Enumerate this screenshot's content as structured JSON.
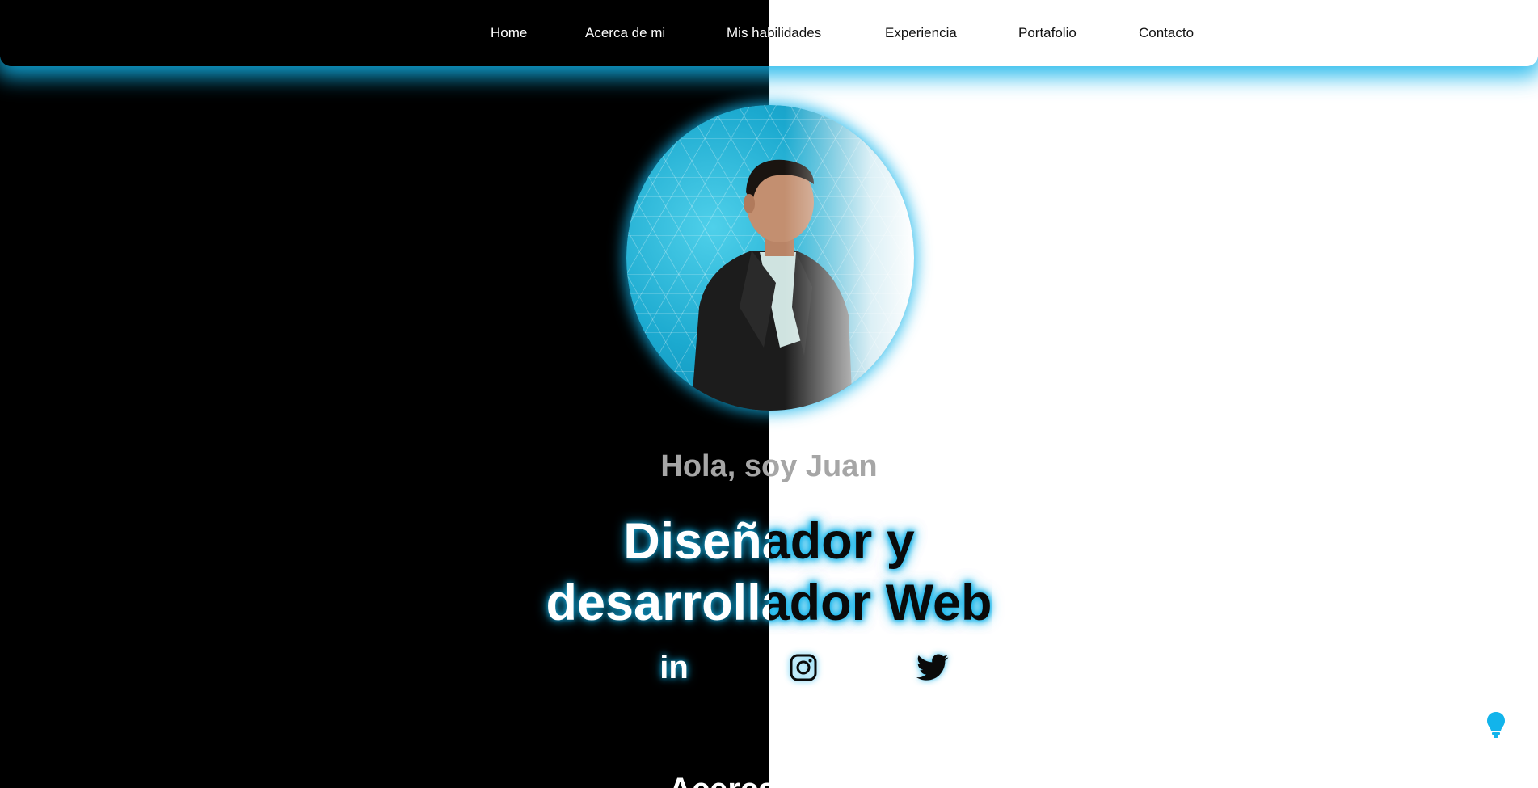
{
  "nav": {
    "items": [
      {
        "label": "Home"
      },
      {
        "label": "Acerca de mi"
      },
      {
        "label": "Mis habilidades"
      },
      {
        "label": "Experiencia"
      },
      {
        "label": "Portafolio"
      },
      {
        "label": "Contacto"
      }
    ]
  },
  "hero": {
    "greeting": "Hola, soy Juan",
    "headline_line1": "Diseñador y",
    "headline_line2": "desarrollador Web"
  },
  "social": {
    "linkedin_label": "in",
    "icons": [
      "linkedin-icon",
      "instagram-icon",
      "twitter-icon"
    ]
  },
  "next_section": {
    "heading": "Acerca de mí"
  },
  "colors": {
    "accent": "#12b4eb",
    "dark_bg": "#000000",
    "light_bg": "#ffffff",
    "greeting": "#a6a6a6"
  }
}
